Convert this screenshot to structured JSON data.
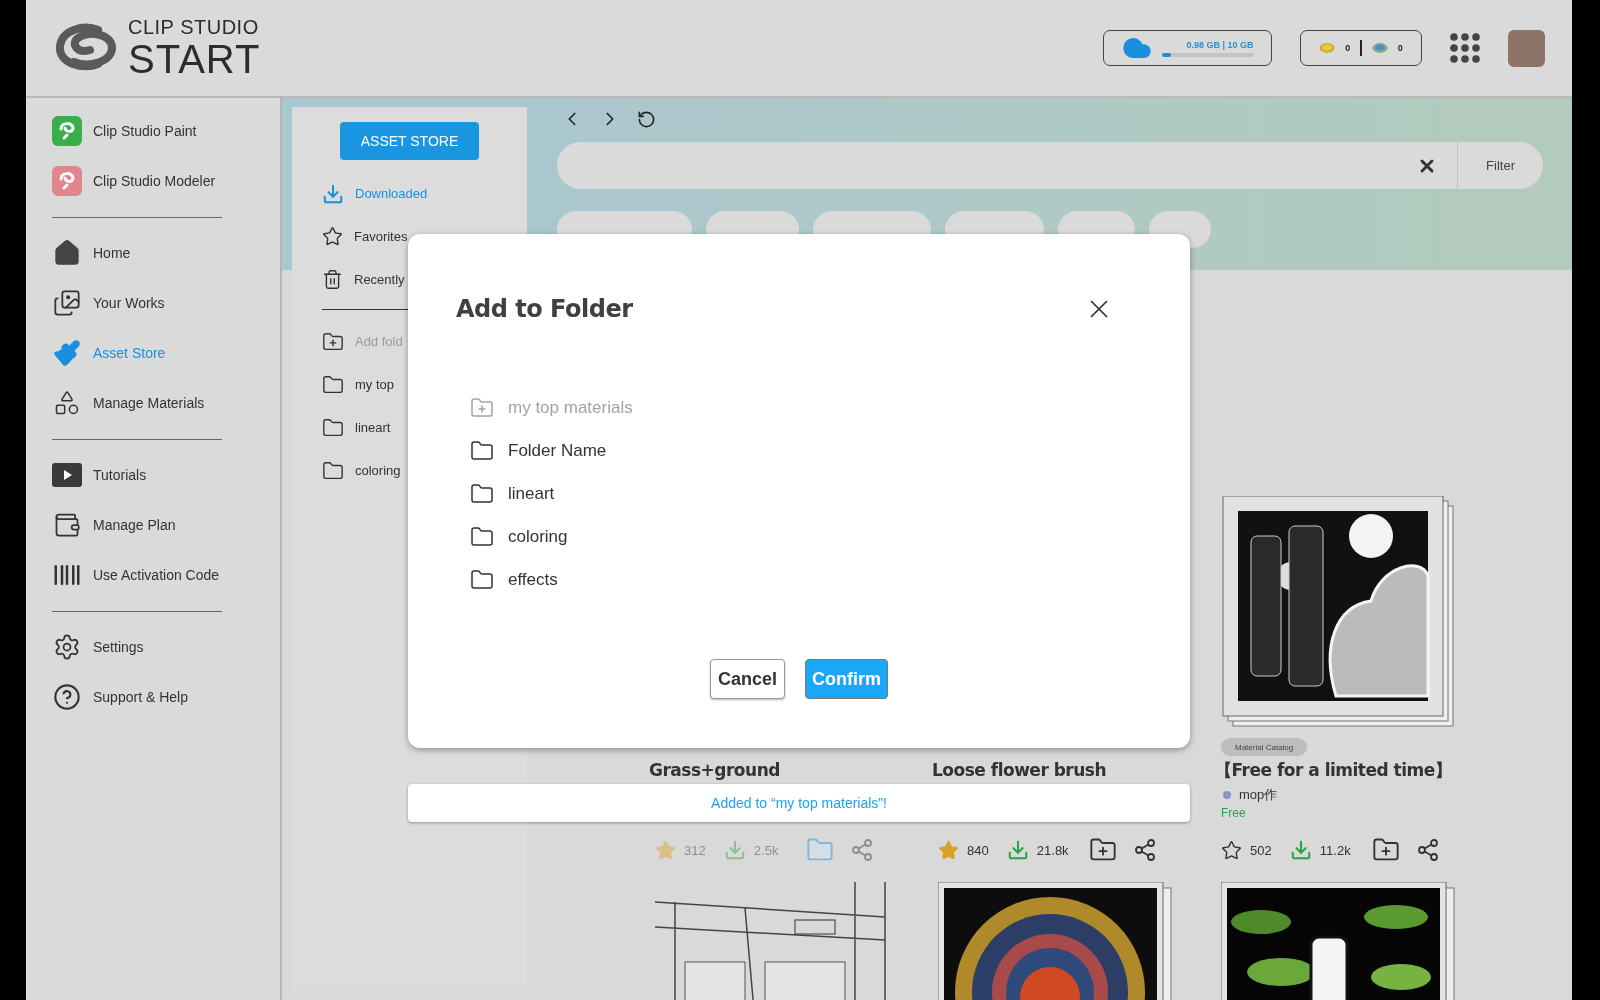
{
  "header": {
    "logo_top": "CLIP STUDIO",
    "logo_bottom": "START",
    "storage": {
      "text": "0.98 GB | 10 GB",
      "level": 0.1
    },
    "coins": [
      {
        "kind": "gold",
        "count": "0"
      },
      {
        "kind": "clip",
        "count": "0"
      }
    ]
  },
  "sidebar": {
    "groups": [
      [
        {
          "label": "Clip Studio Paint",
          "kind": "paint",
          "selected": false
        },
        {
          "label": "Clip Studio Modeler",
          "kind": "modeler",
          "selected": false
        }
      ],
      [
        {
          "label": "Home",
          "kind": "home",
          "selected": false
        },
        {
          "label": "Your Works",
          "kind": "works",
          "selected": false
        },
        {
          "label": "Asset Store",
          "kind": "brush",
          "selected": true
        },
        {
          "label": "Manage Materials",
          "kind": "shapes",
          "selected": false
        }
      ],
      [
        {
          "label": "Tutorials",
          "kind": "play",
          "selected": false
        },
        {
          "label": "Manage Plan",
          "kind": "wallet",
          "selected": false
        },
        {
          "label": "Use Activation Code",
          "kind": "barcode",
          "selected": false
        }
      ],
      [
        {
          "label": "Settings",
          "kind": "settings",
          "selected": false
        },
        {
          "label": "Support & Help",
          "kind": "help",
          "selected": false
        }
      ]
    ]
  },
  "store_panel": {
    "button": "ASSET STORE",
    "items": [
      {
        "label": "Downloaded",
        "kind": "download",
        "selected": true
      },
      {
        "label": "Favorites",
        "kind": "star",
        "selected": false
      },
      {
        "label": "Recently",
        "kind": "trash",
        "selected": false
      }
    ],
    "add_folder": "Add fold",
    "folders": [
      "my top",
      "lineart",
      "coloring"
    ]
  },
  "search": {
    "filter": "Filter"
  },
  "cards": [
    {
      "title": "Grass+ground",
      "favorited": true,
      "stars": "312",
      "downloads": "2.5k",
      "in_folder": true,
      "faded": true
    },
    {
      "title": "Loose flower brush",
      "favorited": true,
      "stars": "840",
      "downloads": "21.8k",
      "in_folder": false,
      "faded": false
    },
    {
      "tag": "Material Catalog",
      "title": "【Free for a limited time】",
      "author": "mop作",
      "price": "Free",
      "favorited": false,
      "stars": "502",
      "downloads": "11.2k",
      "in_folder": false,
      "faded": false
    }
  ],
  "dialog": {
    "title": "Add to Folder",
    "folders": [
      {
        "name": "my top materials",
        "disabled": true
      },
      {
        "name": "Folder Name",
        "disabled": false
      },
      {
        "name": "lineart",
        "disabled": false
      },
      {
        "name": "coloring",
        "disabled": false
      },
      {
        "name": "effects",
        "disabled": false
      }
    ],
    "cancel": "Cancel",
    "confirm": "Confirm"
  },
  "toast": "Added to “my top materials”!"
}
